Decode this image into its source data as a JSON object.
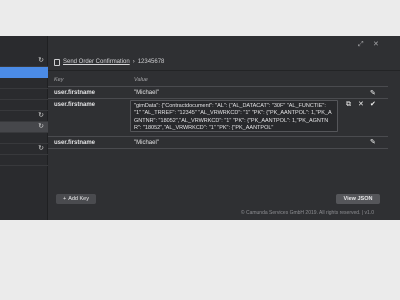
{
  "breadcrumb": {
    "link": "Send Order Confirmation",
    "separator": "›",
    "current": "12345678"
  },
  "table": {
    "headers": {
      "key": "Key",
      "value": "Value"
    },
    "rows": [
      {
        "key": "user.firstname",
        "value": "\"Michael\""
      },
      {
        "key": "user.firstname",
        "value": "\"gimData\": {\"Contractdocument\": \"AL\": {\"AL_DATACAT\": \"30F\" \"AL_FUNCTIE\": \"1\" \"AL_TRREF\": \"12345\" \"AL_VRWRKCD\": \"1\" \"PK\": {\"PK_AANTPOL\": 1,\"PK_AGNTNR\": \"18052\",\"AL_VRWRKCD\": \"1\" \"PK\": {\"PK_AANTPOL\": 1,\"PK_AGNTNR\": \"18052\",\"AL_VRWRKCD\": \"1\" \"PK\": {\"PK_AANTPOL\""
      },
      {
        "key": "user.firstname",
        "value": "\"Michael\""
      }
    ]
  },
  "buttons": {
    "add_key": "Add Key",
    "view_json": "View JSON"
  },
  "footer": "© Camunda Services GmbH 2019. All rights reserved. | v1.0",
  "icons": {
    "pencil": "pencil-icon",
    "copy": "copy-icon",
    "close": "close-icon",
    "check": "check-icon",
    "refresh": "refresh-icon"
  },
  "colors": {
    "panel": "#2f3033",
    "selected": "#4b8be6"
  }
}
